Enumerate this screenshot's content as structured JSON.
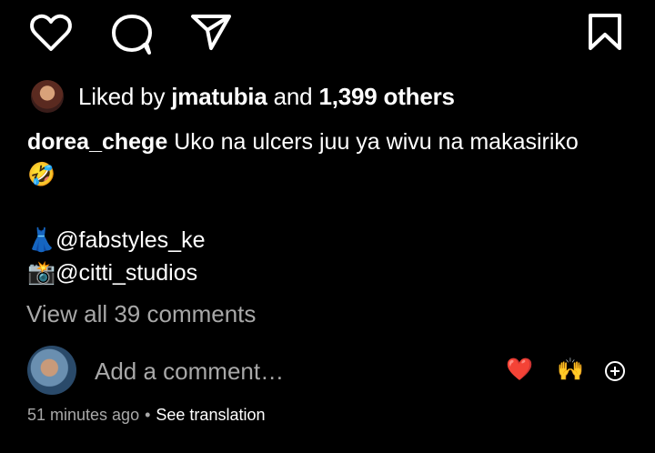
{
  "actions": {
    "like_icon": "heart-outline",
    "comment_icon": "speech-bubble",
    "share_icon": "paper-plane",
    "save_icon": "bookmark"
  },
  "likes": {
    "prefix": "Liked by",
    "user": "jmatubia",
    "middle": "and",
    "count": "1,399 others"
  },
  "caption": {
    "username": "dorea_chege",
    "text": "Uko na ulcers juu ya wivu na makasiriko",
    "emoji": "🤣",
    "credits": [
      {
        "emoji": "👗",
        "handle": "@fabstyles_ke"
      },
      {
        "emoji": "📸",
        "handle": "@citti_studios"
      }
    ]
  },
  "comments": {
    "view_all": "View all 39 comments",
    "placeholder": "Add a comment…",
    "reactions": [
      "❤️",
      "🙌"
    ]
  },
  "meta": {
    "time": "51 minutes ago",
    "separator": "•",
    "translation": "See translation"
  },
  "colors": {
    "background": "#000000",
    "text": "#ffffff",
    "muted": "#a8a8a8",
    "heart": "#ed1c24",
    "hands": "#f7c21b"
  }
}
